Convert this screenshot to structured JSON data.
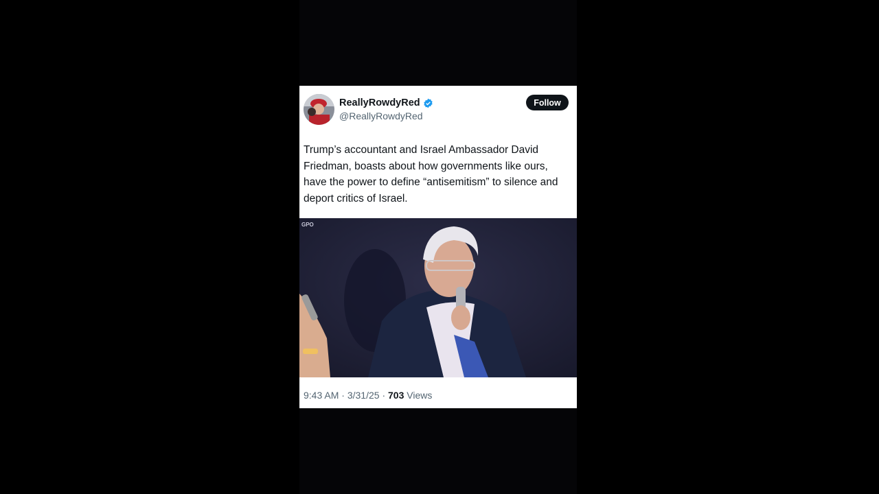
{
  "tweet": {
    "display_name": "ReallyRowdyRed",
    "handle": "@ReallyRowdyRed",
    "follow_label": "Follow",
    "text": "Trump’s accountant and Israel Ambassador David Friedman, boasts about how governments like ours, have the power to define “antisemitism” to silence and deport critics of Israel.",
    "media_watermark": "GPO",
    "time": "9:43 AM",
    "sep1": "·",
    "date": "3/31/25",
    "sep2": "·",
    "views_count": "703",
    "views_label": "Views"
  },
  "colors": {
    "verified": "#1d9bf0",
    "background": "#000000",
    "card": "#ffffff",
    "text": "#0f1419",
    "secondary_text": "#536471"
  },
  "icons": [
    "verified-badge-icon",
    "gpo-logo-icon"
  ]
}
